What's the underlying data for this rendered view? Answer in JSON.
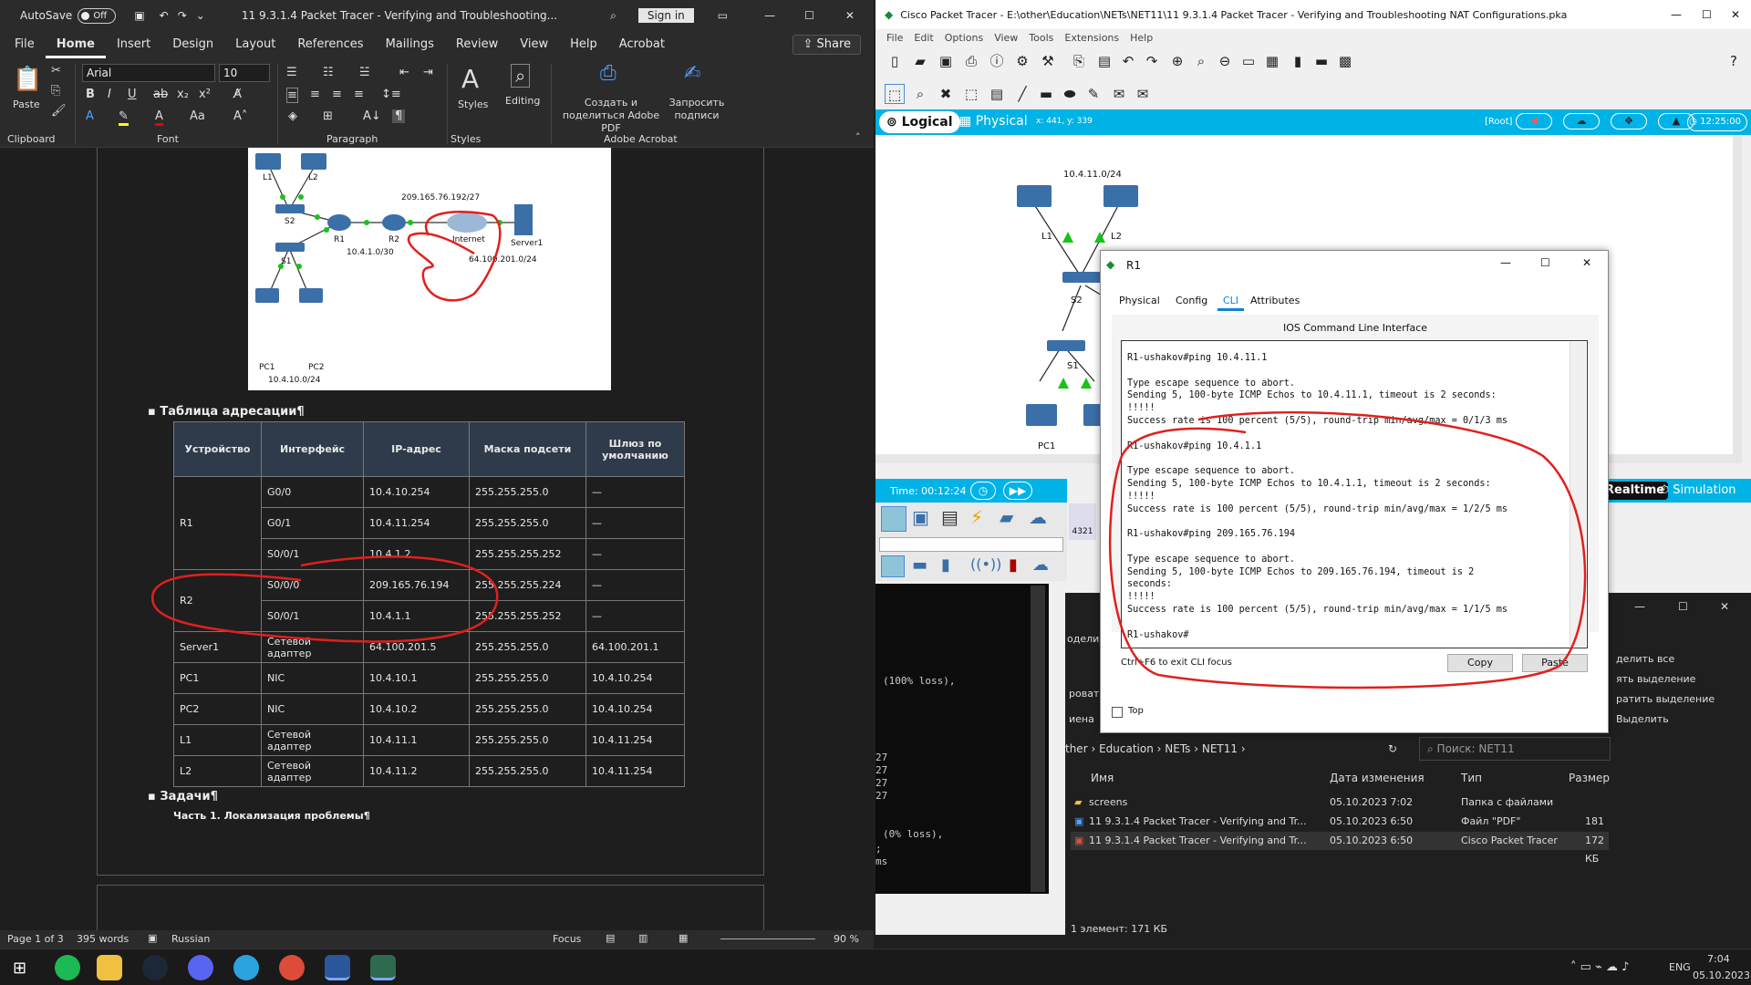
{
  "word": {
    "autosave_label": "AutoSave",
    "autosave_state": "Off",
    "title": "11 9.3.1.4 Packet Tracer - Verifying and Troubleshooting...",
    "signin": "Sign in",
    "tabs": [
      "File",
      "Home",
      "Insert",
      "Design",
      "Layout",
      "References",
      "Mailings",
      "Review",
      "View",
      "Help",
      "Acrobat"
    ],
    "active_tab": "Home",
    "share": "Share",
    "ribbon": {
      "paste": "Paste",
      "font_name": "Arial",
      "font_size": "10",
      "styles": "Styles",
      "editing": "Editing",
      "acrobat_create": "Создать и поделиться Adobe PDF",
      "acrobat_sign": "Запросить подписи",
      "groups": [
        "Clipboard",
        "Font",
        "Paragraph",
        "Styles",
        "Adobe Acrobat"
      ]
    },
    "diagram_labels": {
      "l1": "L1",
      "l2": "L2",
      "s2": "S2",
      "s1": "S1",
      "r1": "R1",
      "r2": "R2",
      "pc1": "PC1",
      "pc2": "PC2",
      "internet": "Internet",
      "server1": "Server1",
      "net_r2": "209.165.76.192/27",
      "net_r1r2": "10.4.1.0/30",
      "net_server": "64.100.201.0/24",
      "net_pc": "10.4.10.0/24"
    },
    "heading_table": "Таблица адресации",
    "table": {
      "headers": [
        "Устройство",
        "Интерфейс",
        "IP-адрес",
        "Маска подсети",
        "Шлюз по умолчанию"
      ],
      "rows": [
        [
          "R1",
          "G0/0",
          "10.4.10.254",
          "255.255.255.0",
          "—"
        ],
        [
          "",
          "G0/1",
          "10.4.11.254",
          "255.255.255.0",
          "—"
        ],
        [
          "",
          "S0/0/1",
          "10.4.1.2",
          "255.255.255.252",
          "—"
        ],
        [
          "R2",
          "S0/0/0",
          "209.165.76.194",
          "255.255.255.224",
          "—"
        ],
        [
          "",
          "S0/0/1",
          "10.4.1.1",
          "255.255.255.252",
          "—"
        ],
        [
          "Server1",
          "Сетевой адаптер",
          "64.100.201.5",
          "255.255.255.0",
          "64.100.201.1"
        ],
        [
          "PC1",
          "NIC",
          "10.4.10.1",
          "255.255.255.0",
          "10.4.10.254"
        ],
        [
          "PC2",
          "NIC",
          "10.4.10.2",
          "255.255.255.0",
          "10.4.10.254"
        ],
        [
          "L1",
          "Сетевой адаптер",
          "10.4.11.1",
          "255.255.255.0",
          "10.4.11.254"
        ],
        [
          "L2",
          "Сетевой адаптер",
          "10.4.11.2",
          "255.255.255.0",
          "10.4.11.254"
        ]
      ]
    },
    "heading_tasks": "Задачи",
    "task1": "Часть 1. Локализация проблемы",
    "status": {
      "page": "Page 1 of 3",
      "words": "395 words",
      "lang": "Russian",
      "focus": "Focus",
      "zoom": "90 %"
    }
  },
  "pt": {
    "title": "Cisco Packet Tracer - E:\\other\\Education\\NETs\\NET11\\11 9.3.1.4 Packet Tracer - Verifying and Troubleshooting NAT Configurations.pka",
    "menu": [
      "File",
      "Edit",
      "Options",
      "View",
      "Tools",
      "Extensions",
      "Help"
    ],
    "logical": "Logical",
    "physical": "Physical",
    "coords": "x: 441, y: 339",
    "root": "[Root]",
    "clock": "12:25:00",
    "time": "Time: 00:12:24",
    "realtime": "Realtime",
    "simulation": "Simulation",
    "device_4321": "4321",
    "topo": {
      "net": "10.4.11.0/24",
      "l1": "L1",
      "l2": "L2",
      "s2": "S2",
      "s1": "S1",
      "pc1": "PC1"
    }
  },
  "r1": {
    "title": "R1",
    "tabs": [
      "Physical",
      "Config",
      "CLI",
      "Attributes"
    ],
    "active_tab": "CLI",
    "cli_header": "IOS Command Line Interface",
    "cli_lines": [
      "R1-ushakov#ping 10.4.11.1",
      "",
      "Type escape sequence to abort.",
      "Sending 5, 100-byte ICMP Echos to 10.4.11.1, timeout is 2 seconds:",
      "!!!!!",
      "Success rate is 100 percent (5/5), round-trip min/avg/max = 0/1/3 ms",
      "",
      "R1-ushakov#ping 10.4.1.1",
      "",
      "Type escape sequence to abort.",
      "Sending 5, 100-byte ICMP Echos to 10.4.1.1, timeout is 2 seconds:",
      "!!!!!",
      "Success rate is 100 percent (5/5), round-trip min/avg/max = 1/2/5 ms",
      "",
      "R1-ushakov#ping 209.165.76.194",
      "",
      "Type escape sequence to abort.",
      "Sending 5, 100-byte ICMP Echos to 209.165.76.194, timeout is 2",
      "seconds:",
      "!!!!!",
      "Success rate is 100 percent (5/5), round-trip min/avg/max = 1/1/5 ms",
      "",
      "R1-ushakov#"
    ],
    "hint": "Ctrl+F6 to exit CLI focus",
    "copy": "Copy",
    "paste": "Paste",
    "top": "Top"
  },
  "console": {
    "l1": "(100% loss),",
    "l2": "27",
    "l3": "27",
    "l4": "27",
    "l5": "27",
    "l6": "(0% loss),",
    "l7": ";",
    "l8": "ms"
  },
  "explorer": {
    "breadcrumb": [
      "ther",
      "Education",
      "NETs",
      "NET11"
    ],
    "search": "Поиск: NET11",
    "side": [
      "делить все",
      "ять выделение",
      "ратить выделение",
      "Выделить"
    ],
    "left_frag": [
      "одели",
      "ровать",
      "иена"
    ],
    "cols": [
      "Имя",
      "Дата изменения",
      "Тип",
      "Размер"
    ],
    "files": [
      {
        "name": "screens",
        "date": "05.10.2023 7:02",
        "type": "Папка с файлами",
        "size": ""
      },
      {
        "name": "11 9.3.1.4 Packet Tracer - Verifying and Tr...",
        "date": "05.10.2023 6:50",
        "type": "Файл \"PDF\"",
        "size": "181 КБ"
      },
      {
        "name": "11 9.3.1.4 Packet Tracer - Verifying and Tr...",
        "date": "05.10.2023 6:50",
        "type": "Cisco Packet Tracer",
        "size": "172 КБ"
      }
    ],
    "status": "1 элемент: 171 КБ"
  },
  "taskbar": {
    "lang": "ENG",
    "time": "7:04",
    "date": "05.10.2023"
  },
  "colors": {
    "annotation": "#e0201e",
    "pt_blue": "#00b3e6",
    "word_dark": "#1e1e1e"
  }
}
